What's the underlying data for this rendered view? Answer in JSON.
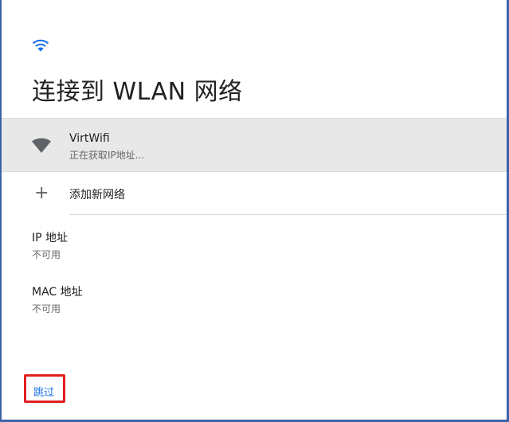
{
  "header": {
    "wifi_icon": "wifi-icon",
    "title": "连接到 WLAN 网络"
  },
  "networks": [
    {
      "name": "VirtWifi",
      "status": "正在获取IP地址...",
      "icon": "wifi-signal-icon"
    }
  ],
  "add_network": {
    "icon": "plus-icon",
    "symbol": "+",
    "label": "添加新网络"
  },
  "ip_address": {
    "label": "IP 地址",
    "value": "不可用"
  },
  "mac_address": {
    "label": "MAC 地址",
    "value": "不可用"
  },
  "footer": {
    "skip_label": "跳过"
  },
  "colors": {
    "accent": "#1a73e8",
    "highlight_border": "#e02020",
    "selected_row_bg": "#e8e8e8",
    "frame_border": "#3b63a8"
  }
}
